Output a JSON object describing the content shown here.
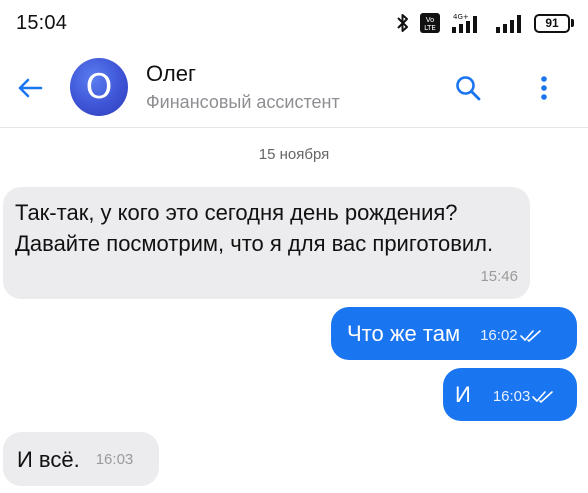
{
  "status_bar": {
    "time": "15:04",
    "network_label": "4G+",
    "volte_label": "Vo LTE",
    "battery": "91"
  },
  "header": {
    "avatar_letter": "O",
    "name": "Олег",
    "subtitle": "Финансовый ассистент"
  },
  "date_separator": "15 ноября",
  "messages": [
    {
      "direction": "in",
      "text": "Так-так, у кого это сегодня день рождения? Давайте посмотрим, что я для вас приготовил.",
      "time": "15:46"
    },
    {
      "direction": "out",
      "text": "Что же там",
      "time": "16:02",
      "read": true
    },
    {
      "direction": "out",
      "text": "И",
      "time": "16:03",
      "read": true
    },
    {
      "direction": "in",
      "text": "И всё.",
      "time": "16:03"
    }
  ],
  "icons": {
    "back": "arrow-left-icon",
    "search": "search-icon",
    "menu": "more-vertical-icon",
    "bluetooth": "bluetooth-icon",
    "signal": "signal-icon",
    "battery": "battery-icon",
    "read_ticks": "double-check-icon"
  },
  "colors": {
    "accent": "#1976f0",
    "avatar": "#3e54d6",
    "incoming_bubble": "#ececee",
    "outgoing_bubble": "#1976f0"
  }
}
